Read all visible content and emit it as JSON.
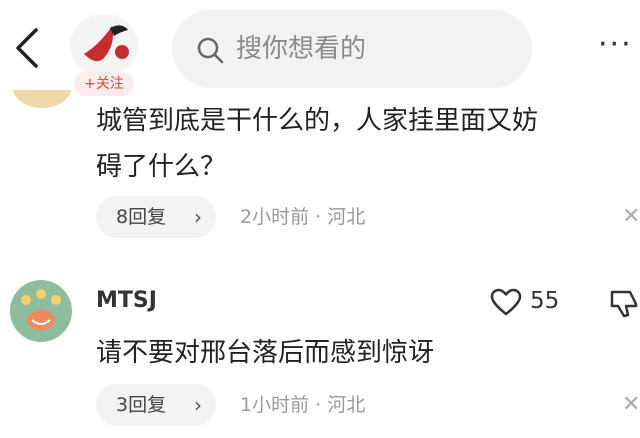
{
  "header": {
    "follow_label": "+关注",
    "search_placeholder": "搜你想看的",
    "more_label": "···"
  },
  "comments": [
    {
      "text_line1": "城管到底是干什么的，人家挂里面又妨",
      "text_line2": "碍了什么？",
      "reply_label": "8回复",
      "meta": "2小时前 · 河北"
    },
    {
      "username": "MTSJ",
      "likes": "55",
      "text": "请不要对邢台落后而感到惊讶",
      "reply_label": "3回复",
      "meta": "1小时前 · 河北"
    }
  ],
  "icons": {
    "back": "chevron-left-icon",
    "search": "search-icon",
    "like": "heart-icon",
    "dislike": "thumbs-down-icon",
    "close": "close-icon",
    "reply_chevron": "chevron-right-icon"
  },
  "colors": {
    "accent": "#e8452e",
    "chip_bg": "#f3f3f3",
    "meta_text": "#9a9a9a"
  }
}
